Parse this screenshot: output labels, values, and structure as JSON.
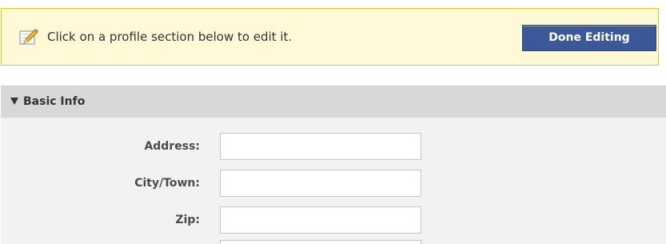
{
  "notice": {
    "icon": "pencil-icon",
    "message": "Click on a profile section below to edit it.",
    "done_label": "Done Editing"
  },
  "section": {
    "icon": "triangle-down-icon",
    "title": "Basic Info",
    "fields": [
      {
        "label": "Address:",
        "value": "",
        "placeholder": ""
      },
      {
        "label": "City/Town:",
        "value": "",
        "placeholder": ""
      },
      {
        "label": "Zip:",
        "value": "",
        "placeholder": ""
      }
    ]
  },
  "colors": {
    "notice_background": "#fff9d7",
    "notice_border": "#e2c822",
    "button_blue": "#3b5998",
    "section_header": "#d8d8d8",
    "section_body": "#f2f2f2"
  }
}
